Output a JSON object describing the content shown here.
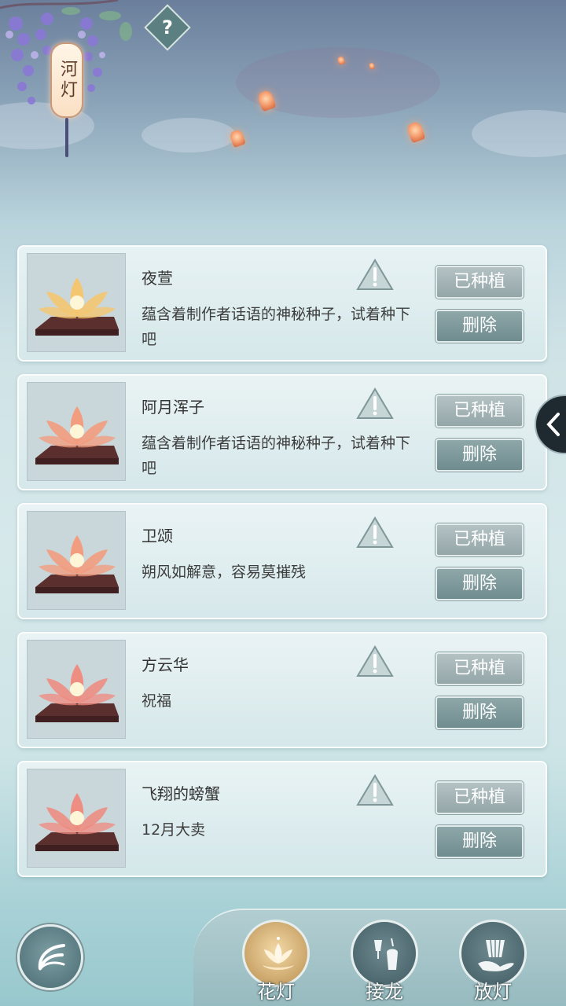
{
  "header": {
    "sign_label": "河灯",
    "help_label": "?"
  },
  "items": [
    {
      "name": "夜萱",
      "desc": "蕴含着制作者话语的神秘种子，试着种下吧",
      "planted_label": "已种植",
      "delete_label": "删除",
      "lantern_color": "#f7c56a"
    },
    {
      "name": "阿月浑子",
      "desc": "蕴含着制作者话语的神秘种子，试着种下吧",
      "planted_label": "已种植",
      "delete_label": "删除",
      "lantern_color": "#f49a7a"
    },
    {
      "name": "卫颂",
      "desc": "朔风如解意，容易莫摧残",
      "planted_label": "已种植",
      "delete_label": "删除",
      "lantern_color": "#f49a7a"
    },
    {
      "name": "方云华",
      "desc": "祝福",
      "planted_label": "已种植",
      "delete_label": "删除",
      "lantern_color": "#f08a7e"
    },
    {
      "name": "飞翔的螃蟹",
      "desc": "12月大卖",
      "planted_label": "已种植",
      "delete_label": "删除",
      "lantern_color": "#f08a7e"
    }
  ],
  "tabs": [
    {
      "label": "花灯",
      "icon": "lotus-icon",
      "active": true
    },
    {
      "label": "接龙",
      "icon": "lantern-chain-icon",
      "active": false
    },
    {
      "label": "放灯",
      "icon": "release-lantern-icon",
      "active": false
    }
  ],
  "icons": {
    "back": "back-arrow-icon",
    "side_toggle": "chevron-left-icon",
    "report": "warning-icon"
  },
  "colors": {
    "button": "#7b9598",
    "card_bg": "#e2eeef",
    "active_tab": "#d8b57a"
  }
}
